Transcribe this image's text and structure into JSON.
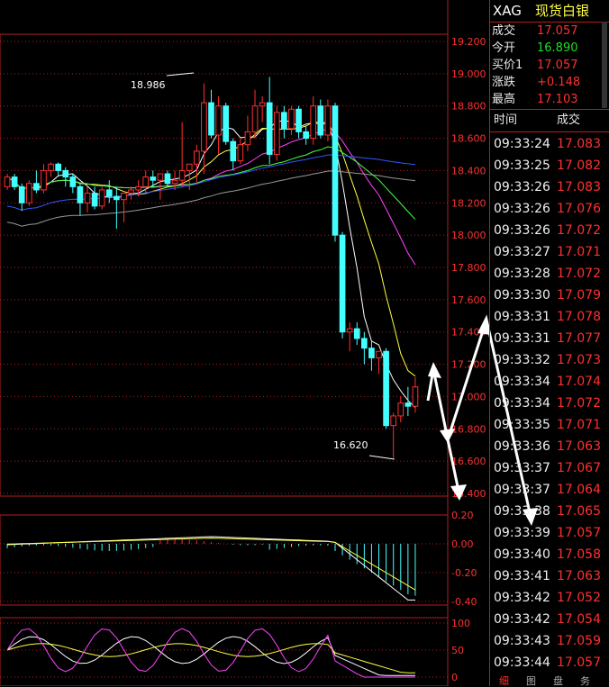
{
  "header": {
    "symbol": "XAG",
    "name": "现货白银"
  },
  "quote": [
    {
      "label": "成交",
      "value": "17.057",
      "color": "#ff3030"
    },
    {
      "label": "今开",
      "value": "16.890",
      "color": "#22dd22"
    },
    {
      "label": "买价1",
      "value": "17.057",
      "color": "#ff3030"
    },
    {
      "label": "涨跌",
      "value": "+0.148",
      "color": "#ff3030"
    },
    {
      "label": "最高",
      "value": "17.103",
      "color": "#ff3030"
    }
  ],
  "ticks_header": {
    "time": "时间",
    "price": "成交"
  },
  "ticks": [
    {
      "time": "09:33:24",
      "price": "17.083"
    },
    {
      "time": "09:33:25",
      "price": "17.082"
    },
    {
      "time": "09:33:26",
      "price": "17.083"
    },
    {
      "time": "09:33:26",
      "price": "17.076"
    },
    {
      "time": "09:33:26",
      "price": "17.072"
    },
    {
      "time": "09:33:27",
      "price": "17.071"
    },
    {
      "time": "09:33:28",
      "price": "17.072"
    },
    {
      "time": "09:33:30",
      "price": "17.079"
    },
    {
      "time": "09:33:31",
      "price": "17.078"
    },
    {
      "time": "09:33:31",
      "price": "17.077"
    },
    {
      "time": "09:33:32",
      "price": "17.073"
    },
    {
      "time": "09:33:34",
      "price": "17.074"
    },
    {
      "time": "09:33:34",
      "price": "17.072"
    },
    {
      "time": "09:33:35",
      "price": "17.071"
    },
    {
      "time": "09:33:36",
      "price": "17.063"
    },
    {
      "time": "09:33:37",
      "price": "17.067"
    },
    {
      "time": "09:33:37",
      "price": "17.064"
    },
    {
      "time": "09:33:38",
      "price": "17.065"
    },
    {
      "time": "09:33:39",
      "price": "17.057"
    },
    {
      "time": "09:33:40",
      "price": "17.058"
    },
    {
      "time": "09:33:41",
      "price": "17.063"
    },
    {
      "time": "09:33:42",
      "price": "17.052"
    },
    {
      "time": "09:33:42",
      "price": "17.054"
    },
    {
      "time": "09:33:43",
      "price": "17.059"
    },
    {
      "time": "09:33:44",
      "price": "17.057"
    }
  ],
  "bottom_tabs": [
    "细",
    "图",
    "盘",
    "务"
  ],
  "chart_data": [
    {
      "type": "candlestick",
      "ylim": [
        16.4,
        19.2
      ],
      "yticks": [
        "19.200",
        "19.000",
        "18.800",
        "18.600",
        "18.400",
        "18.200",
        "18.000",
        "17.800",
        "17.600",
        "17.400",
        "17.200",
        "17.000",
        "16.800",
        "16.600",
        "16.400"
      ],
      "annotations": [
        "18.986",
        "16.620"
      ],
      "candles": [
        [
          18.3,
          18.38,
          18.28,
          18.36
        ],
        [
          18.36,
          18.38,
          18.28,
          18.3
        ],
        [
          18.3,
          18.32,
          18.15,
          18.2
        ],
        [
          18.2,
          18.34,
          18.18,
          18.32
        ],
        [
          18.32,
          18.4,
          18.26,
          18.28
        ],
        [
          18.28,
          18.44,
          18.26,
          18.4
        ],
        [
          18.4,
          18.45,
          18.36,
          18.44
        ],
        [
          18.44,
          18.45,
          18.37,
          18.4
        ],
        [
          18.4,
          18.42,
          18.3,
          18.36
        ],
        [
          18.36,
          18.38,
          18.26,
          18.3
        ],
        [
          18.3,
          18.32,
          18.12,
          18.2
        ],
        [
          18.2,
          18.3,
          18.14,
          18.26
        ],
        [
          18.26,
          18.3,
          18.16,
          18.18
        ],
        [
          18.18,
          18.3,
          18.16,
          18.28
        ],
        [
          18.28,
          18.34,
          18.2,
          18.24
        ],
        [
          18.24,
          18.3,
          18.04,
          18.22
        ],
        [
          18.22,
          18.26,
          18.08,
          18.26
        ],
        [
          18.26,
          18.3,
          18.22,
          18.28
        ],
        [
          18.28,
          18.34,
          18.24,
          18.3
        ],
        [
          18.3,
          18.4,
          18.26,
          18.36
        ],
        [
          18.36,
          18.4,
          18.3,
          18.34
        ],
        [
          18.34,
          18.38,
          18.22,
          18.38
        ],
        [
          18.38,
          18.4,
          18.3,
          18.32
        ],
        [
          18.32,
          18.4,
          18.28,
          18.34
        ],
        [
          18.34,
          18.7,
          18.3,
          18.4
        ],
        [
          18.4,
          18.44,
          18.28,
          18.44
        ],
        [
          18.44,
          18.56,
          18.32,
          18.52
        ],
        [
          18.52,
          18.94,
          18.38,
          18.82
        ],
        [
          18.82,
          18.9,
          18.6,
          18.62
        ],
        [
          18.62,
          18.86,
          18.5,
          18.8
        ],
        [
          18.8,
          18.82,
          18.56,
          18.58
        ],
        [
          18.58,
          18.6,
          18.4,
          18.46
        ],
        [
          18.46,
          18.6,
          18.44,
          18.56
        ],
        [
          18.56,
          18.74,
          18.52,
          18.64
        ],
        [
          18.64,
          18.9,
          18.6,
          18.8
        ],
        [
          18.8,
          18.86,
          18.7,
          18.82
        ],
        [
          18.82,
          18.98,
          18.44,
          18.5
        ],
        [
          18.5,
          18.8,
          18.46,
          18.76
        ],
        [
          18.76,
          18.8,
          18.6,
          18.66
        ],
        [
          18.66,
          18.8,
          18.62,
          18.78
        ],
        [
          18.78,
          18.8,
          18.6,
          18.64
        ],
        [
          18.64,
          18.68,
          18.56,
          18.6
        ],
        [
          18.6,
          18.86,
          18.56,
          18.8
        ],
        [
          18.8,
          18.84,
          18.6,
          18.62
        ],
        [
          18.62,
          18.84,
          18.58,
          18.8
        ],
        [
          18.8,
          18.82,
          17.96,
          18.0
        ],
        [
          18.0,
          18.02,
          17.36,
          17.4
        ],
        [
          17.4,
          17.46,
          17.28,
          17.42
        ],
        [
          17.42,
          17.46,
          17.32,
          17.36
        ],
        [
          17.36,
          17.4,
          17.2,
          17.3
        ],
        [
          17.3,
          17.34,
          17.16,
          17.24
        ],
        [
          17.24,
          17.28,
          17.14,
          17.28
        ],
        [
          17.28,
          17.3,
          16.8,
          16.82
        ],
        [
          16.82,
          16.9,
          16.62,
          16.88
        ],
        [
          16.88,
          17.0,
          16.84,
          16.96
        ],
        [
          16.96,
          17.06,
          16.88,
          16.94
        ],
        [
          16.94,
          17.12,
          16.9,
          17.06
        ]
      ]
    },
    {
      "type": "bar",
      "ylim": [
        -0.4,
        0.2
      ],
      "yticks": [
        "0.20",
        "0.00",
        "-0.20",
        "-0.40"
      ]
    },
    {
      "type": "line",
      "ylim": [
        0,
        100
      ],
      "yticks": [
        "100",
        "50",
        "0"
      ]
    }
  ],
  "colors": {
    "up": "#ff3030",
    "down": "#44ffff",
    "grid": "#b41e1e",
    "axis": "#b41e1e",
    "label": "#ff3030"
  }
}
